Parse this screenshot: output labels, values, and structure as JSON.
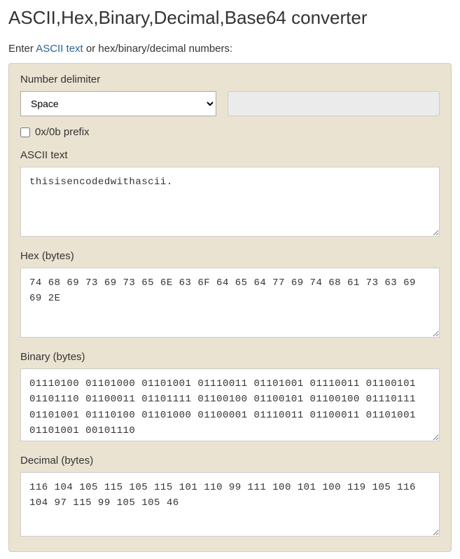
{
  "title": "ASCII,Hex,Binary,Decimal,Base64 converter",
  "intro": {
    "prefix": "Enter ",
    "link": "ASCII text",
    "suffix": " or hex/binary/decimal numbers:"
  },
  "labels": {
    "delimiter": "Number delimiter",
    "prefix": "0x/0b prefix",
    "ascii": "ASCII text",
    "hex": "Hex (bytes)",
    "binary": "Binary (bytes)",
    "decimal": "Decimal (bytes)"
  },
  "delimiter": {
    "selected": "Space",
    "custom": ""
  },
  "prefix_checked": false,
  "values": {
    "ascii": "thisisencodedwithascii.",
    "hex": "74 68 69 73 69 73 65 6E 63 6F 64 65 64 77 69 74 68 61 73 63 69 69 2E",
    "binary": "01110100 01101000 01101001 01110011 01101001 01110011 01100101 01101110 01100011 01101111 01100100 01100101 01100100 01110111 01101001 01110100 01101000 01100001 01110011 01100011 01101001 01101001 00101110",
    "decimal": "116 104 105 115 105 115 101 110 99 111 100 101 100 119 105 116 104 97 115 99 105 105 46"
  }
}
